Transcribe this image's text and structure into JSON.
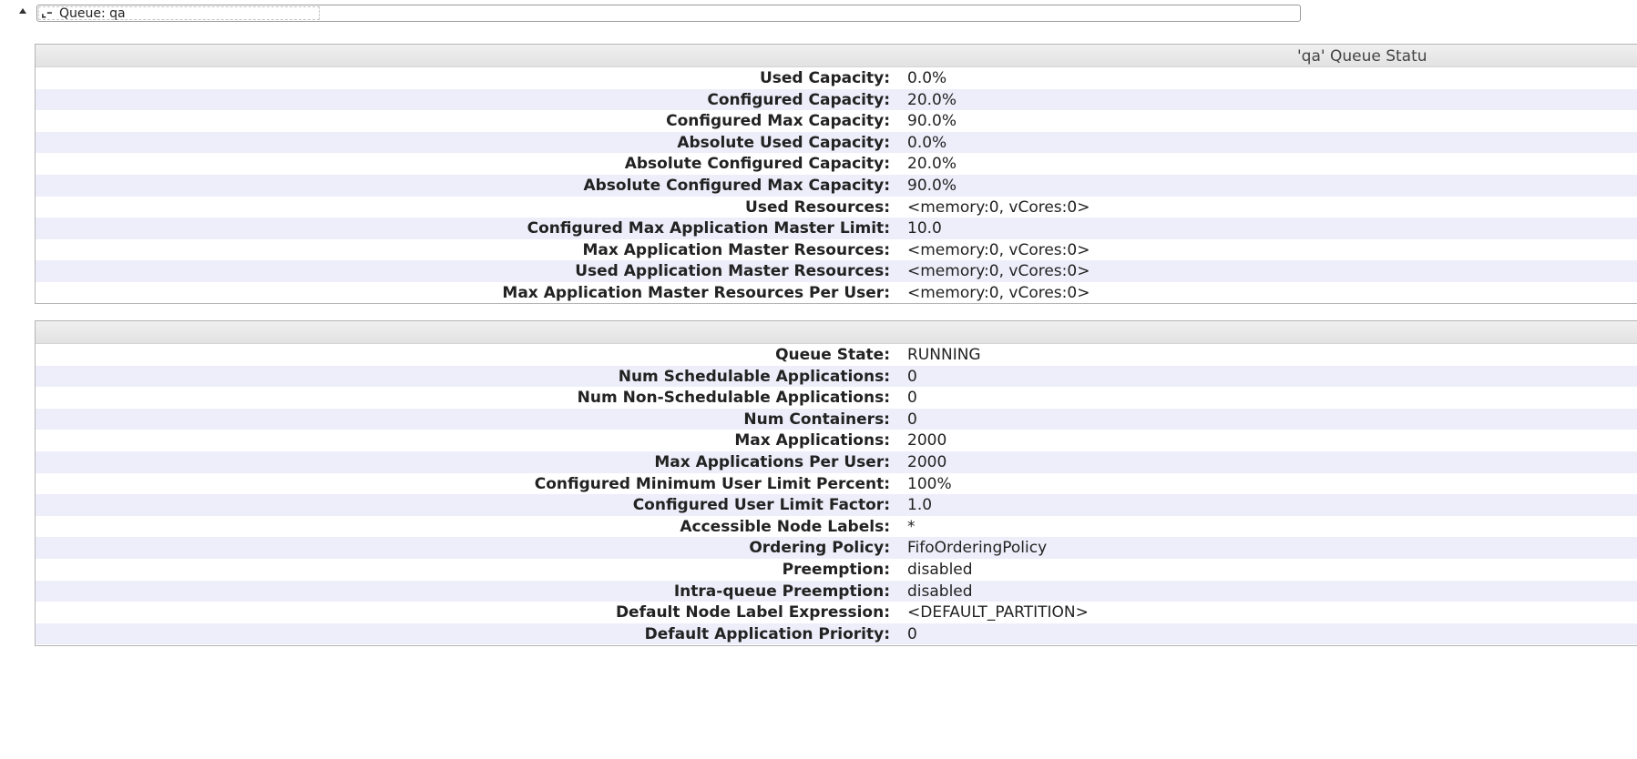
{
  "queue_header": {
    "label": "Queue: qa",
    "toggle_icon": "triangle-up",
    "collapse_icon": "minus-icon"
  },
  "status_box": {
    "caption": "'qa' Queue Statu",
    "rows": [
      {
        "label": "Used Capacity:",
        "value": "0.0%"
      },
      {
        "label": "Configured Capacity:",
        "value": "20.0%"
      },
      {
        "label": "Configured Max Capacity:",
        "value": "90.0%"
      },
      {
        "label": "Absolute Used Capacity:",
        "value": "0.0%"
      },
      {
        "label": "Absolute Configured Capacity:",
        "value": "20.0%"
      },
      {
        "label": "Absolute Configured Max Capacity:",
        "value": "90.0%"
      },
      {
        "label": "Used Resources:",
        "value": "<memory:0, vCores:0>"
      },
      {
        "label": "Configured Max Application Master Limit:",
        "value": "10.0"
      },
      {
        "label": "Max Application Master Resources:",
        "value": "<memory:0, vCores:0>"
      },
      {
        "label": "Used Application Master Resources:",
        "value": "<memory:0, vCores:0>"
      },
      {
        "label": "Max Application Master Resources Per User:",
        "value": "<memory:0, vCores:0>"
      }
    ]
  },
  "details_box": {
    "caption": "",
    "rows": [
      {
        "label": "Queue State:",
        "value": "RUNNING"
      },
      {
        "label": "Num Schedulable Applications:",
        "value": "0"
      },
      {
        "label": "Num Non-Schedulable Applications:",
        "value": "0"
      },
      {
        "label": "Num Containers:",
        "value": "0"
      },
      {
        "label": "Max Applications:",
        "value": "2000"
      },
      {
        "label": "Max Applications Per User:",
        "value": "2000"
      },
      {
        "label": "Configured Minimum User Limit Percent:",
        "value": "100%"
      },
      {
        "label": "Configured User Limit Factor:",
        "value": "1.0"
      },
      {
        "label": "Accessible Node Labels:",
        "value": "*"
      },
      {
        "label": "Ordering Policy:",
        "value": "FifoOrderingPolicy"
      },
      {
        "label": "Preemption:",
        "value": "disabled"
      },
      {
        "label": "Intra-queue Preemption:",
        "value": "disabled"
      },
      {
        "label": "Default Node Label Expression:",
        "value": "<DEFAULT_PARTITION>"
      },
      {
        "label": "Default Application Priority:",
        "value": "0"
      }
    ]
  },
  "colors": {
    "row_stripe": "#eeeefb",
    "border": "#b5b5b5",
    "caption_bg": "#e6e6e6"
  }
}
